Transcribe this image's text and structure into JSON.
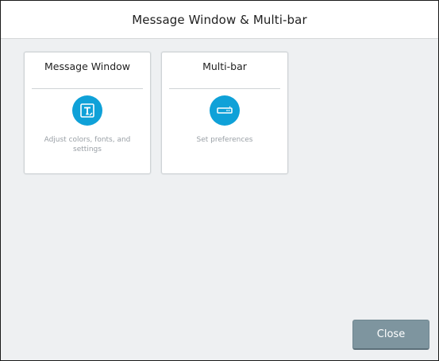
{
  "window": {
    "title": "Message Window & Multi-bar"
  },
  "cards": [
    {
      "title": "Message Window",
      "icon": "text-box-icon",
      "description": "Adjust colors, fonts, and settings"
    },
    {
      "title": "Multi-bar",
      "icon": "multi-bar-icon",
      "description": "Set preferences"
    }
  ],
  "footer": {
    "close_label": "Close"
  },
  "colors": {
    "accent": "#0fa1d8",
    "button": "#7e959f",
    "background": "#eef0f2"
  }
}
